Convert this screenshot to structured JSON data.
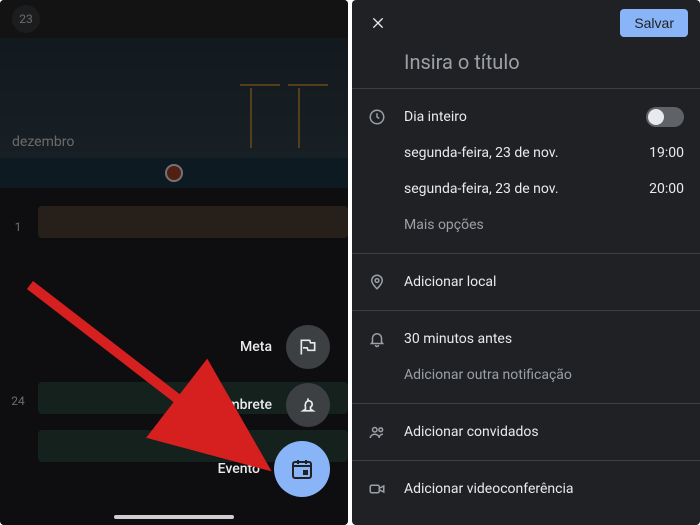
{
  "left": {
    "topbar_day": "23",
    "month_label": "dezembro",
    "fab": {
      "meta": "Meta",
      "lembrete": "Lembrete",
      "evento": "Evento"
    }
  },
  "right": {
    "save": "Salvar",
    "title_placeholder": "Insira o título",
    "allday": "Dia inteiro",
    "start_date": "segunda-feira, 23 de nov.",
    "start_time": "19:00",
    "end_date": "segunda-feira, 23 de nov.",
    "end_time": "20:00",
    "more_options": "Mais opções",
    "add_location": "Adicionar local",
    "reminder": "30 minutos antes",
    "add_notification": "Adicionar outra notificação",
    "add_guests": "Adicionar convidados",
    "add_video": "Adicionar videoconferência"
  }
}
